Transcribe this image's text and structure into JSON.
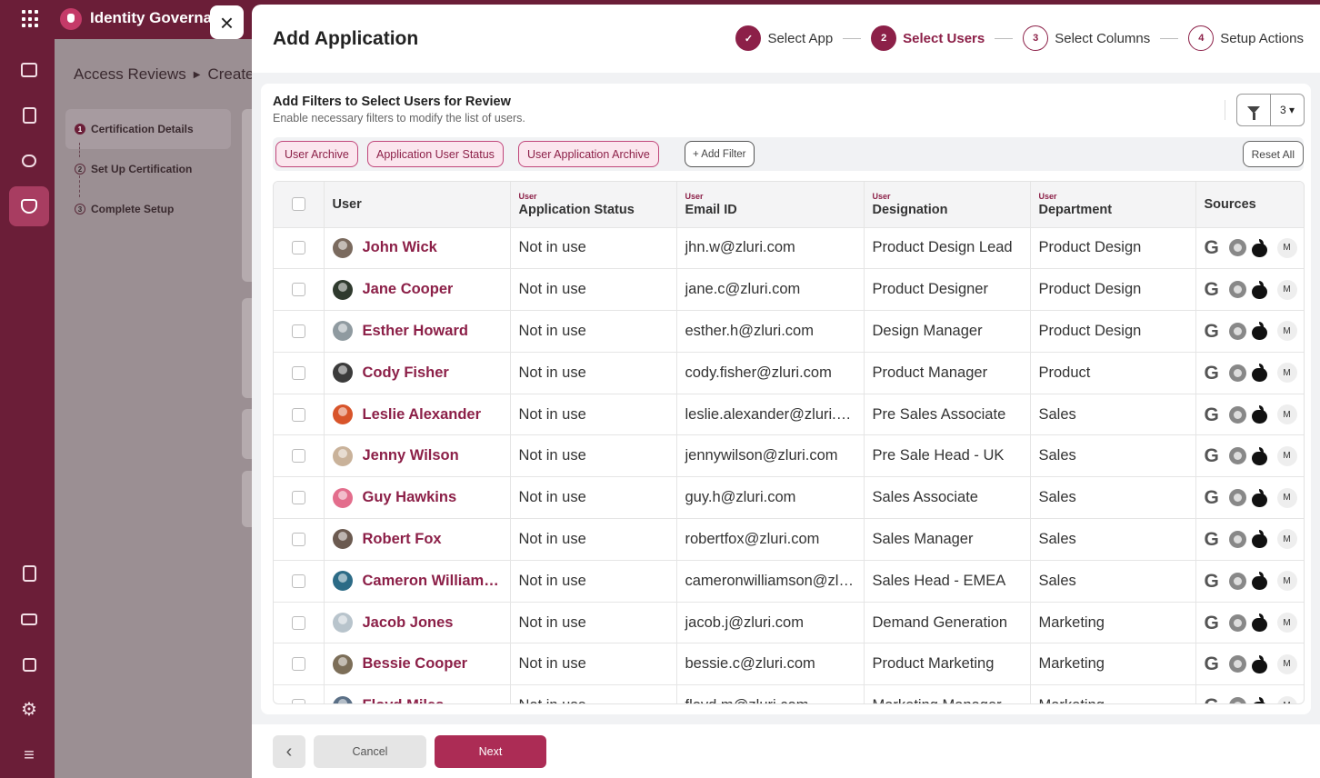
{
  "app": {
    "name": "Identity Governance"
  },
  "breadcrumb": {
    "root": "Access Reviews",
    "current": "Create"
  },
  "background_steps": [
    {
      "num": "1",
      "label": "Certification Details"
    },
    {
      "num": "2",
      "label": "Set Up Certification"
    },
    {
      "num": "3",
      "label": "Complete Setup"
    }
  ],
  "modal": {
    "title": "Add Application",
    "steps": [
      {
        "num": "✓",
        "label": "Select App",
        "state": "done"
      },
      {
        "num": "2",
        "label": "Select Users",
        "state": "current"
      },
      {
        "num": "3",
        "label": "Select Columns",
        "state": "upcoming"
      },
      {
        "num": "4",
        "label": "Setup Actions",
        "state": "upcoming"
      }
    ]
  },
  "filters": {
    "title": "Add Filters to Select Users for Review",
    "subtitle": "Enable necessary filters to modify the list of users.",
    "filter_count": "3 ▾",
    "chips": [
      "User Archive",
      "Application User Status",
      "User Application Archive"
    ],
    "add_filter": "+ Add Filter",
    "reset": "Reset All"
  },
  "table": {
    "columns": [
      {
        "tag": "",
        "label": "User"
      },
      {
        "tag": "User",
        "label": "Application Status"
      },
      {
        "tag": "User",
        "label": "Email ID"
      },
      {
        "tag": "User",
        "label": "Designation"
      },
      {
        "tag": "User",
        "label": "Department"
      },
      {
        "tag": "",
        "label": "Sources"
      }
    ],
    "source_m": "M",
    "rows": [
      {
        "name": "John Wick",
        "status": "Not in use",
        "email": "jhn.w@zluri.com",
        "designation": "Product Design Lead",
        "department": "Product Design",
        "avatar": "#7a6a5e"
      },
      {
        "name": "Jane Cooper",
        "status": "Not in use",
        "email": "jane.c@zluri.com",
        "designation": "Product Designer",
        "department": "Product Design",
        "avatar": "#2f3a2e"
      },
      {
        "name": "Esther Howard",
        "status": "Not in use",
        "email": "esther.h@zluri.com",
        "designation": "Design Manager",
        "department": "Product Design",
        "avatar": "#8f9aa0"
      },
      {
        "name": "Cody Fisher",
        "status": "Not in use",
        "email": "cody.fisher@zluri.com",
        "designation": "Product Manager",
        "department": "Product",
        "avatar": "#3b3b3b"
      },
      {
        "name": "Leslie Alexander",
        "status": "Not in use",
        "email": "leslie.alexander@zluri.com",
        "designation": "Pre Sales Associate",
        "department": "Sales",
        "avatar": "#d8542a"
      },
      {
        "name": "Jenny Wilson",
        "status": "Not in use",
        "email": "jennywilson@zluri.com",
        "designation": "Pre Sale Head - UK",
        "department": "Sales",
        "avatar": "#c9b29a"
      },
      {
        "name": "Guy Hawkins",
        "status": "Not in use",
        "email": "guy.h@zluri.com",
        "designation": "Sales Associate",
        "department": "Sales",
        "avatar": "#e36d8c"
      },
      {
        "name": "Robert Fox",
        "status": "Not in use",
        "email": "robertfox@zluri.com",
        "designation": "Sales Manager",
        "department": "Sales",
        "avatar": "#6b5a50"
      },
      {
        "name": "Cameron Williamson",
        "status": "Not in use",
        "email": "cameronwilliamson@zluri.com",
        "designation": "Sales Head - EMEA",
        "department": "Sales",
        "avatar": "#2c6b86"
      },
      {
        "name": "Jacob Jones",
        "status": "Not in use",
        "email": "jacob.j@zluri.com",
        "designation": "Demand Generation",
        "department": "Marketing",
        "avatar": "#b8c4cc"
      },
      {
        "name": "Bessie Cooper",
        "status": "Not in use",
        "email": "bessie.c@zluri.com",
        "designation": "Product Marketing",
        "department": "Marketing",
        "avatar": "#7c6e58"
      },
      {
        "name": "Floyd Miles",
        "status": "Not in use",
        "email": "floyd.m@zluri.com",
        "designation": "Marketing Manager",
        "department": "Marketing",
        "avatar": "#5a6f86"
      }
    ]
  },
  "footer": {
    "back": "‹",
    "cancel": "Cancel",
    "next": "Next"
  },
  "colors": {
    "brand": "#6b1e38",
    "accent": "#8c2048",
    "chip_bg": "#fbe6ee",
    "next_button": "#ac2c55"
  },
  "icons": [
    "apps-grid-icon",
    "close-icon",
    "google-icon",
    "okta-icon",
    "apple-icon",
    "filter-icon",
    "settings-icon"
  ]
}
